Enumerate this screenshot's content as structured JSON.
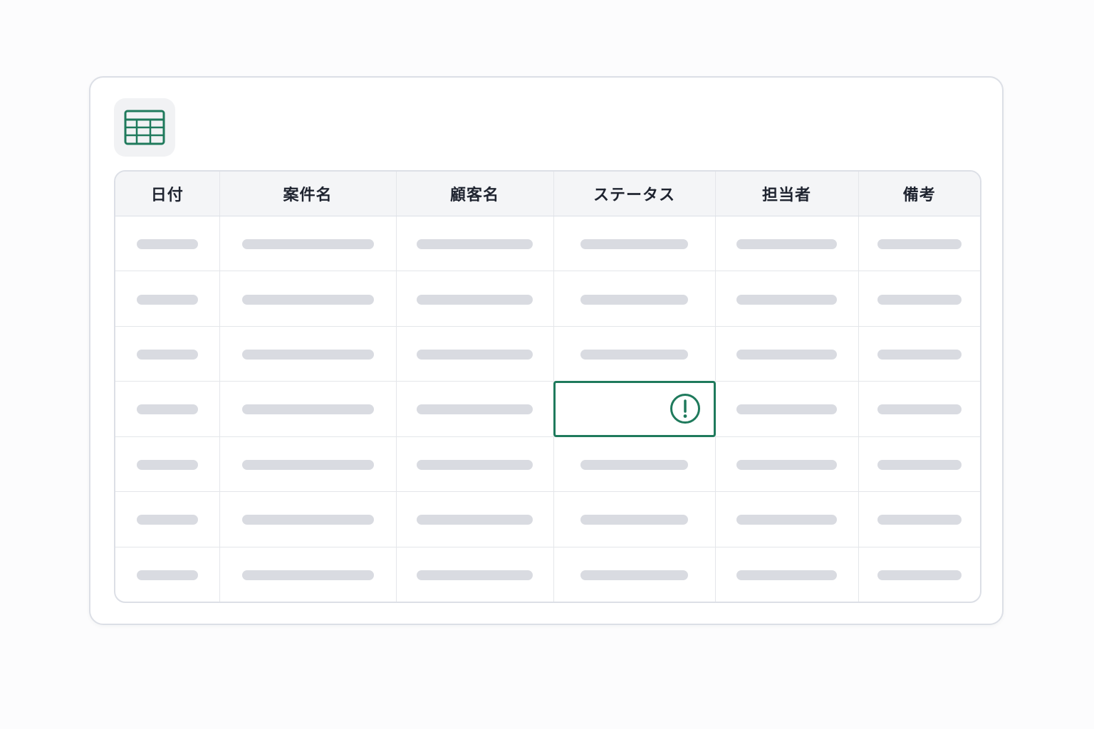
{
  "colors": {
    "accent": "#1f7a5c",
    "placeholder_bar": "#d9dbe1",
    "header_bg": "#f4f5f7",
    "border": "#dcdfe6"
  },
  "app_icon": "spreadsheet-icon",
  "table": {
    "columns": [
      "日付",
      "案件名",
      "顧客名",
      "ステータス",
      "担当者",
      "備考"
    ],
    "row_count": 7,
    "cells": "placeholder",
    "error_cell": {
      "row": 4,
      "column": "ステータス",
      "icon": "alert-circle-icon"
    }
  }
}
